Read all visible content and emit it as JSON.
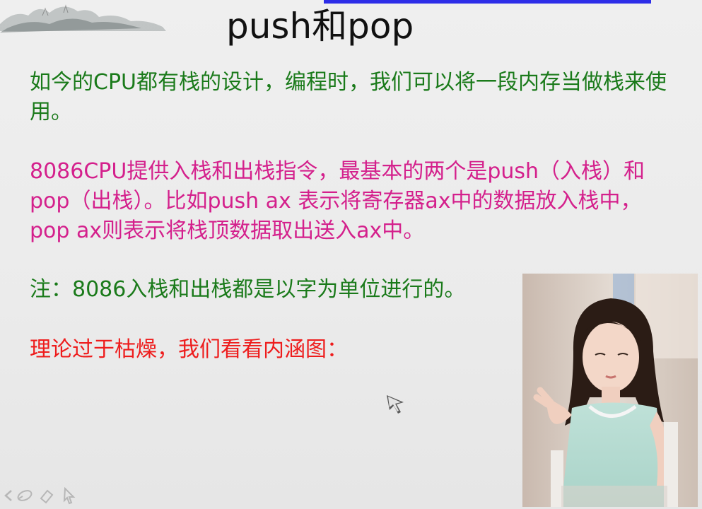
{
  "slide": {
    "title": "push和pop",
    "paragraphs": [
      {
        "text": "如今的CPU都有栈的设计，编程时，我们可以将一段内存当做栈来使用。",
        "color": "#1a7a1a"
      },
      {
        "text": "8086CPU提供入栈和出栈指令，最基本的两个是push（入栈）和pop（出栈）。比如push ax 表示将寄存器ax中的数据放入栈中，pop ax则表示将栈顶数据取出送入ax中。",
        "color": "#d4208c"
      },
      {
        "text": "注：8086入栈和出栈都是以字为单位进行的。",
        "color": "#1a7a1a"
      },
      {
        "text": "理论过于枯燥，我们看看内涵图：",
        "color": "#ee1c1c"
      }
    ]
  },
  "icons": {
    "decoration": "landscape-ink-painting",
    "cursor": "pointer-cursor-icon",
    "photo": "photo-of-woman"
  },
  "toolbar": {
    "tools": [
      "previous-arrow-icon",
      "pen-icon",
      "eraser-icon",
      "pointer-icon"
    ]
  },
  "colors": {
    "title_underline": "#2d2de8",
    "green_text": "#1a7a1a",
    "magenta_text": "#d4208c",
    "red_text": "#ee1c1c"
  }
}
